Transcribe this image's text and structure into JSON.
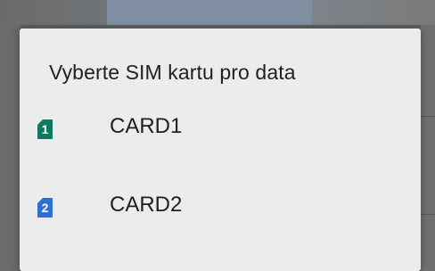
{
  "dialog": {
    "title": "Vyberte SIM kartu pro data",
    "options": [
      {
        "label": "CARD1",
        "slot": "1",
        "icon": "sim-card-icon",
        "color": "#0b7a63"
      },
      {
        "label": "CARD2",
        "slot": "2",
        "icon": "sim-card-icon",
        "color": "#2f6fd1"
      }
    ]
  }
}
